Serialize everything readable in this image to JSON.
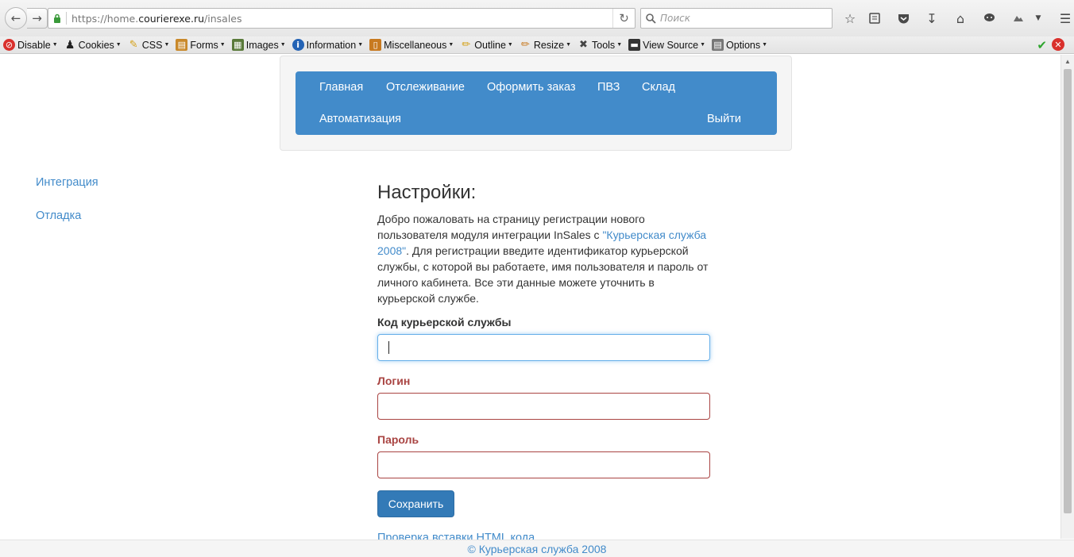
{
  "browser": {
    "url_prefix": "https://home.",
    "url_host": "courierexe.ru",
    "url_path": "/insales",
    "search_placeholder": "Поиск"
  },
  "devtoolbar": {
    "items": [
      "Disable",
      "Cookies",
      "CSS",
      "Forms",
      "Images",
      "Information",
      "Miscellaneous",
      "Outline",
      "Resize",
      "Tools",
      "View Source",
      "Options"
    ]
  },
  "menu": {
    "home": "Главная",
    "tracking": "Отслеживание",
    "order": "Оформить заказ",
    "pvz": "ПВЗ",
    "warehouse": "Склад",
    "automation": "Автоматизация",
    "logout": "Выйти"
  },
  "sidebar": {
    "items": [
      "Интеграция",
      "Отладка"
    ]
  },
  "content": {
    "title": "Настройки:",
    "intro_before": "Добро пожаловать на страницу регистрации нового пользователя модуля интеграции InSales с ",
    "intro_link": "\"Курьерская служба 2008\"",
    "intro_after": ". Для регистрации введите идентификатор курьерской службы, с которой вы работаете, имя пользователя и пароль от личного кабинета. Все эти данные можете уточнить в курьерской службе.",
    "courier_code_label": "Код курьерской службы",
    "courier_code_value": "",
    "login_label": "Логин",
    "login_value": "",
    "password_label": "Пароль",
    "password_value": "",
    "save_label": "Сохранить",
    "html_check_link": "Проверка вставки HTML кода"
  },
  "footer": {
    "text": "© Курьерская служба 2008"
  },
  "colors": {
    "primary": "#428bca",
    "error": "#a94442",
    "focus": "#66afe9"
  }
}
